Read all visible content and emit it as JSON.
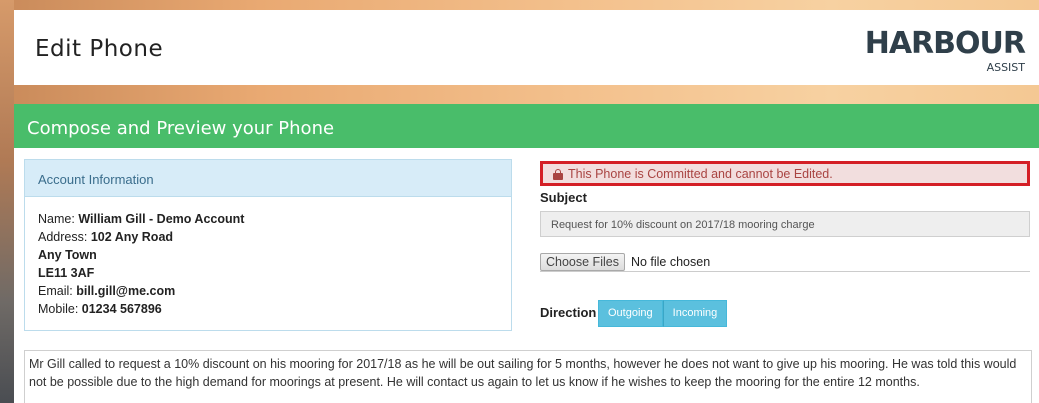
{
  "header": {
    "title": "Edit Phone",
    "logo_main": "HARBOUR",
    "logo_sub": "ASSIST"
  },
  "banner": {
    "title": "Compose and Preview your Phone"
  },
  "account": {
    "heading": "Account Information",
    "name_label": "Name:",
    "name_value": "William Gill - Demo Account",
    "address_label": "Address:",
    "address_line1": "102 Any Road",
    "address_line2": "Any Town",
    "address_line3": "LE11 3AF",
    "email_label": "Email:",
    "email_value": "bill.gill@me.com",
    "mobile_label": "Mobile:",
    "mobile_value": "01234 567896"
  },
  "alert": {
    "text": "This Phone is Committed and cannot be Edited.",
    "icon": "lock-icon"
  },
  "subject": {
    "label": "Subject",
    "value": "Request for 10% discount on 2017/18 mooring charge"
  },
  "files": {
    "button_label": "Choose Files",
    "status": "No file chosen"
  },
  "direction": {
    "label": "Direction",
    "options": [
      "Outgoing",
      "Incoming"
    ]
  },
  "notes": {
    "text": "Mr Gill called to request a 10% discount on his mooring for 2017/18 as he will be out sailing for 5 months, however he does not want to give up his mooring.  He was told this would not be possible due to the high demand for moorings at present.  He will contact us again to let us know if he wishes to keep the mooring for the entire 12 months."
  },
  "colors": {
    "banner": "#49bd6a",
    "alert_border": "#d41f26",
    "direction_button": "#5bc0de"
  }
}
